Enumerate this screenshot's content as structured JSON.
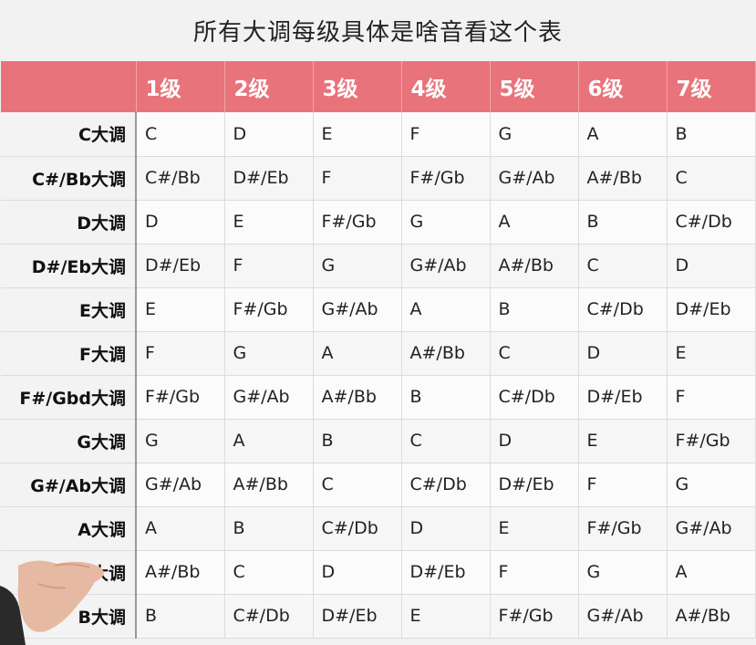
{
  "title": "所有大调每级具体是啥音看这个表",
  "header": {
    "corner": "",
    "degrees": [
      "1级",
      "2级",
      "3级",
      "4级",
      "5级",
      "6级",
      "7级"
    ]
  },
  "rows": [
    {
      "key": "C大调",
      "notes": [
        "C",
        "D",
        "E",
        "F",
        "G",
        "A",
        "B"
      ]
    },
    {
      "key": "C#/Bb大调",
      "notes": [
        "C#/Bb",
        "D#/Eb",
        "F",
        "F#/Gb",
        "G#/Ab",
        "A#/Bb",
        "C"
      ]
    },
    {
      "key": "D大调",
      "notes": [
        "D",
        "E",
        "F#/Gb",
        "G",
        "A",
        "B",
        "C#/Db"
      ]
    },
    {
      "key": "D#/Eb大调",
      "notes": [
        "D#/Eb",
        "F",
        "G",
        "G#/Ab",
        "A#/Bb",
        "C",
        "D"
      ]
    },
    {
      "key": "E大调",
      "notes": [
        "E",
        "F#/Gb",
        "G#/Ab",
        "A",
        "B",
        "C#/Db",
        "D#/Eb"
      ]
    },
    {
      "key": "F大调",
      "notes": [
        "F",
        "G",
        "A",
        "A#/Bb",
        "C",
        "D",
        "E"
      ]
    },
    {
      "key": "F#/Gbd大调",
      "notes": [
        "F#/Gb",
        "G#/Ab",
        "A#/Bb",
        "B",
        "C#/Db",
        "D#/Eb",
        "F"
      ]
    },
    {
      "key": "G大调",
      "notes": [
        "G",
        "A",
        "B",
        "C",
        "D",
        "E",
        "F#/Gb"
      ]
    },
    {
      "key": "G#/Ab大调",
      "notes": [
        "G#/Ab",
        "A#/Bb",
        "C",
        "C#/Db",
        "D#/Eb",
        "F",
        "G"
      ]
    },
    {
      "key": "A大调",
      "notes": [
        "A",
        "B",
        "C#/Db",
        "D",
        "E",
        "F#/Gb",
        "G#/Ab"
      ]
    },
    {
      "key": "A#/Bb大调",
      "notes": [
        "A#/Bb",
        "C",
        "D",
        "D#/Eb",
        "F",
        "G",
        "A"
      ]
    },
    {
      "key": "B大调",
      "notes": [
        "B",
        "C#/Db",
        "D#/Eb",
        "E",
        "F#/Gb",
        "G#/Ab",
        "A#/Bb"
      ]
    }
  ],
  "colors": {
    "header_bg": "#e8737a",
    "header_text": "#ffffff",
    "row_header_bg": "#f3f3f3",
    "cell_bg": "#fbfbfb",
    "page_bg": "#f2f2f2"
  }
}
